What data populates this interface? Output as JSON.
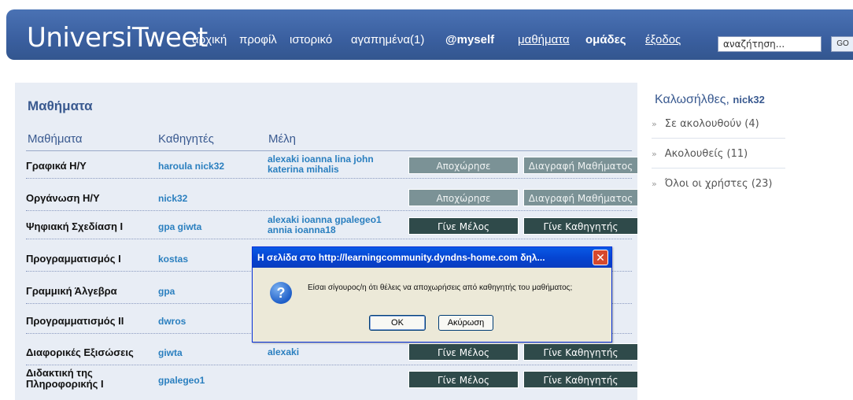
{
  "header": {
    "logo": "UniversiTweet",
    "nav": {
      "home": "αρχική",
      "profile": "προφίλ",
      "history": "ιστορικό",
      "favorites": "αγαπημένα(1)",
      "myself": "@myself",
      "courses": "μαθήματα",
      "groups": "ομάδες",
      "logout": "έξοδος"
    },
    "search_value": "αναζήτηση...",
    "go_label": "GO"
  },
  "panel": {
    "title": "Μαθήματα",
    "columns": {
      "courses": "Μαθήματα",
      "professors": "Καθηγητές",
      "members": "Μέλη"
    },
    "rows": [
      {
        "course": "Γραφικά Η/Υ",
        "professors": "haroula nick32",
        "members": "alexaki ioanna lina john katerina mihalis",
        "btn1": "Αποχώρησε",
        "btn2": "Διαγραφή Μαθήματος"
      },
      {
        "course": "Οργάνωση Η/Υ",
        "professors": "nick32",
        "members": "",
        "btn1": "Αποχώρησε",
        "btn2": "Διαγραφή Μαθήματος"
      },
      {
        "course": "Ψηφιακή Σχεδίαση Ι",
        "professors": "gpa giwta",
        "members": "alexaki ioanna gpalegeo1 annia ioanna18",
        "btn1": "Γίνε Μέλος",
        "btn2": "Γίνε Καθηγητής"
      },
      {
        "course": "Προγραμματισμός Ι",
        "professors": "kostas",
        "members": "",
        "btn1": "",
        "btn2": ""
      },
      {
        "course": "Γραμμική Άλγεβρα",
        "professors": "gpa",
        "members": "",
        "btn1": "",
        "btn2": ""
      },
      {
        "course": "Προγραμματισμός ΙΙ",
        "professors": "dwros",
        "members": "",
        "btn1": "",
        "btn2": ""
      },
      {
        "course": "Διαφορικές Εξισώσεις",
        "professors": "giwta",
        "members": "alexaki",
        "btn1": "Γίνε Μέλος",
        "btn2": "Γίνε Καθηγητής"
      },
      {
        "course": "Διδακτική της Πληροφορικής Ι",
        "professors": "gpalegeo1",
        "members": "",
        "btn1": "Γίνε Μέλος",
        "btn2": "Γίνε Καθηγητής"
      }
    ]
  },
  "sidebar": {
    "welcome": "Καλωσήλθες,",
    "username": "nick32",
    "items": [
      {
        "label": "Σε ακολουθούν (4)"
      },
      {
        "label": "Ακολουθείς (11)"
      },
      {
        "label": "Όλοι οι χρήστες (23)"
      }
    ],
    "arrow": "»"
  },
  "dialog": {
    "title": "Η σελίδα στο http://learningcommunity.dyndns-home.com δηλ...",
    "close": "✕",
    "icon": "?",
    "message": "Είσαι σίγουρος/η ότι θέλεις να αποχωρήσεις από καθηγητής του μαθήματος;",
    "ok": "OK",
    "cancel": "Ακύρωση"
  },
  "colors": {
    "header": "#3a5f9f",
    "panel_bg": "#e8edf5",
    "link": "#2a7fbf",
    "btn_grey": "#7b9296",
    "btn_dark": "#2f4a4a"
  }
}
